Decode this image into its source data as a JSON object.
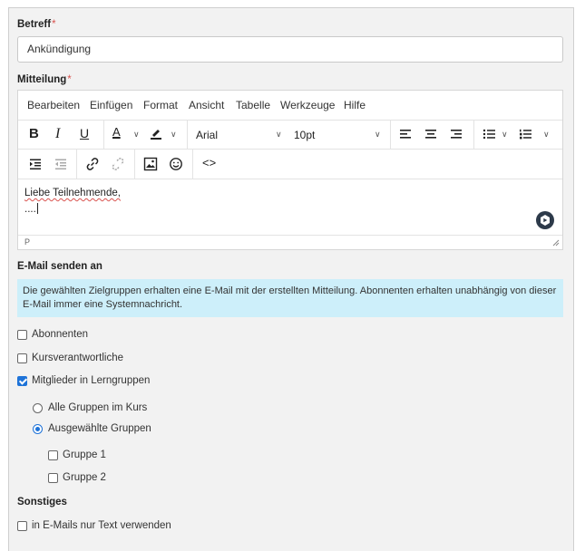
{
  "form": {
    "subject_label": "Betreff",
    "required_mark": "*",
    "subject_value": "Ankündigung",
    "message_label": "Mitteilung"
  },
  "editor": {
    "menu": [
      "Bearbeiten",
      "Einfügen",
      "Format",
      "Ansicht",
      "Tabelle",
      "Werkzeuge",
      "Hilfe"
    ],
    "font_family": "Arial",
    "font_size": "10pt",
    "content_line1": "Liebe Teilnehmende,",
    "content_line2": "....",
    "status_path": "P",
    "icons": [
      "bold-icon",
      "italic-icon",
      "underline-icon",
      "text-color-icon",
      "highlight-icon",
      "align-left-icon",
      "align-center-icon",
      "align-right-icon",
      "bullet-list-icon",
      "numbered-list-icon",
      "indent-icon",
      "outdent-icon",
      "link-icon",
      "unlink-icon",
      "image-icon",
      "emoji-icon",
      "code-icon"
    ]
  },
  "email": {
    "section_label": "E-Mail senden an",
    "info_text": "Die gewählten Zielgruppen erhalten eine E-Mail mit der erstellten Mitteilung. Abonnenten erhalten unabhängig von dieser E-Mail immer eine Systemnachricht.",
    "options": [
      {
        "label": "Abonnenten",
        "checked": false
      },
      {
        "label": "Kursverantwortliche",
        "checked": false
      },
      {
        "label": "Mitglieder in Lerngruppen",
        "checked": true
      }
    ],
    "group_scope": [
      {
        "label": "Alle Gruppen im Kurs",
        "selected": false
      },
      {
        "label": "Ausgewählte Gruppen",
        "selected": true
      }
    ],
    "groups": [
      {
        "label": "Gruppe 1",
        "checked": false
      },
      {
        "label": "Gruppe 2",
        "checked": false
      }
    ]
  },
  "misc": {
    "section_label": "Sonstiges",
    "text_only_label": "in E-Mails nur Text verwenden",
    "text_only_checked": false
  },
  "colors": {
    "accent": "#1e73d8",
    "info_bg": "#cdeffa",
    "required": "#d9534f"
  }
}
